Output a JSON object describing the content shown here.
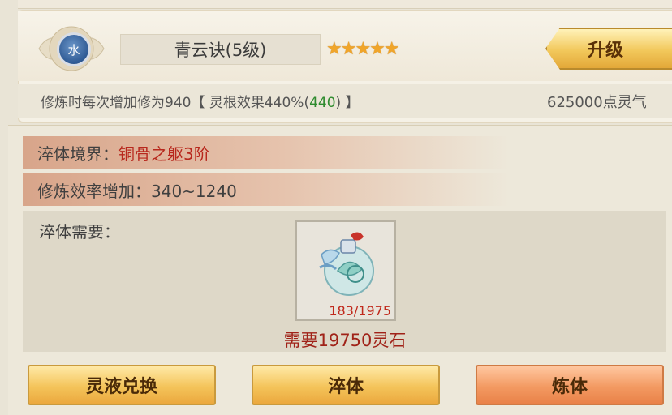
{
  "skill": {
    "element_label": "水",
    "name": "青云诀(5级)",
    "stars": "★★★★★",
    "star_count": 5,
    "upgrade_label": "升级",
    "desc_prefix": "修炼时每次增加修为940【 灵根效果440%(",
    "desc_green": "440",
    "desc_suffix": ") 】",
    "cost": "625000点灵气"
  },
  "temper": {
    "realm_label": "淬体境界：",
    "realm_value": "铜骨之躯3阶",
    "efficiency_label": "修炼效率增加：340~1240",
    "need_label": "淬体需要：",
    "item_icon": "potion-bottle-icon",
    "item_count": "183/1975",
    "need_stone": "需要19750灵石"
  },
  "buttons": {
    "exchange": "灵液兑换",
    "temper": "淬体",
    "refine": "炼体"
  },
  "colors": {
    "accent_red": "#b8281d",
    "green": "#2e8b2e",
    "button_gold": "#f4c45a",
    "button_orange": "#f39a62"
  }
}
